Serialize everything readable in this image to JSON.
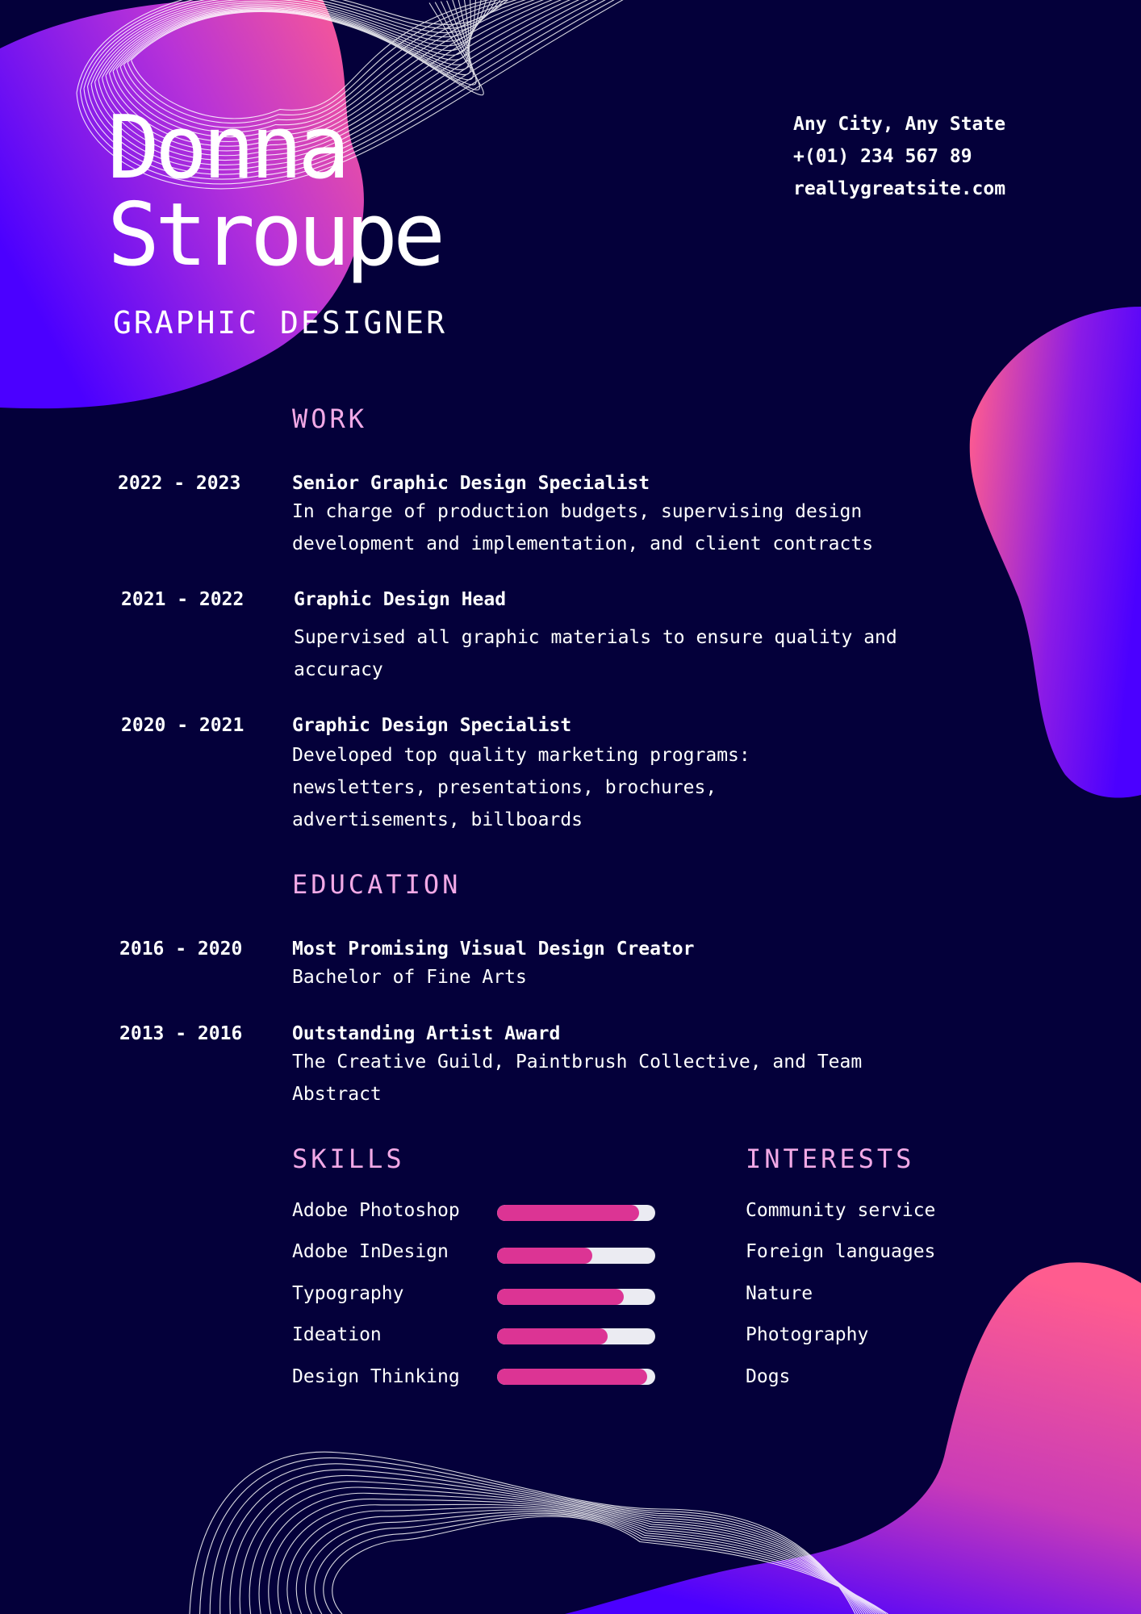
{
  "profile": {
    "first_name": "Donna",
    "last_name": "Stroupe",
    "title": "GRAPHIC DESIGNER"
  },
  "contact": {
    "location": "Any City, Any State",
    "phone": "+(01) 234 567 89",
    "website": "reallygreatsite.com"
  },
  "work": {
    "heading": "WORK",
    "entries": [
      {
        "years": "2022 - 2023",
        "title": "Senior Graphic Design Specialist",
        "description": "In charge of production budgets, supervising design development and implementation, and client contracts"
      },
      {
        "years": "2021 - 2022",
        "title": "Graphic Design Head",
        "description": "Supervised all graphic materials to ensure quality and accuracy"
      },
      {
        "years": "2020 - 2021",
        "title": "Graphic Design Specialist",
        "description": "Developed top quality marketing programs: newsletters, presentations, brochures, advertisements, billboards"
      }
    ]
  },
  "education": {
    "heading": "EDUCATION",
    "entries": [
      {
        "years": "2016 - 2020",
        "title": "Most Promising Visual Design Creator",
        "description": "Bachelor of Fine Arts"
      },
      {
        "years": "2013 - 2016",
        "title": "Outstanding Artist Award",
        "description": "The Creative Guild, Paintbrush Collective, and Team Abstract"
      }
    ]
  },
  "skills": {
    "heading": "SKILLS",
    "items": [
      {
        "label": "Adobe Photoshop",
        "level": 0.9
      },
      {
        "label": "Adobe InDesign",
        "level": 0.6
      },
      {
        "label": "Typography",
        "level": 0.8
      },
      {
        "label": "Ideation",
        "level": 0.7
      },
      {
        "label": "Design Thinking",
        "level": 0.95
      }
    ]
  },
  "interests": {
    "heading": "INTERESTS",
    "items": [
      "Community service",
      "Foreign languages",
      "Nature",
      "Photography",
      "Dogs"
    ]
  },
  "colors": {
    "background": "#04003a",
    "heading": "#f2a9e6",
    "bar_fill": "#dc3494",
    "bar_track": "#ebebf2",
    "gradient_pink": "#ff5c95",
    "gradient_violet": "#4a00ff"
  }
}
